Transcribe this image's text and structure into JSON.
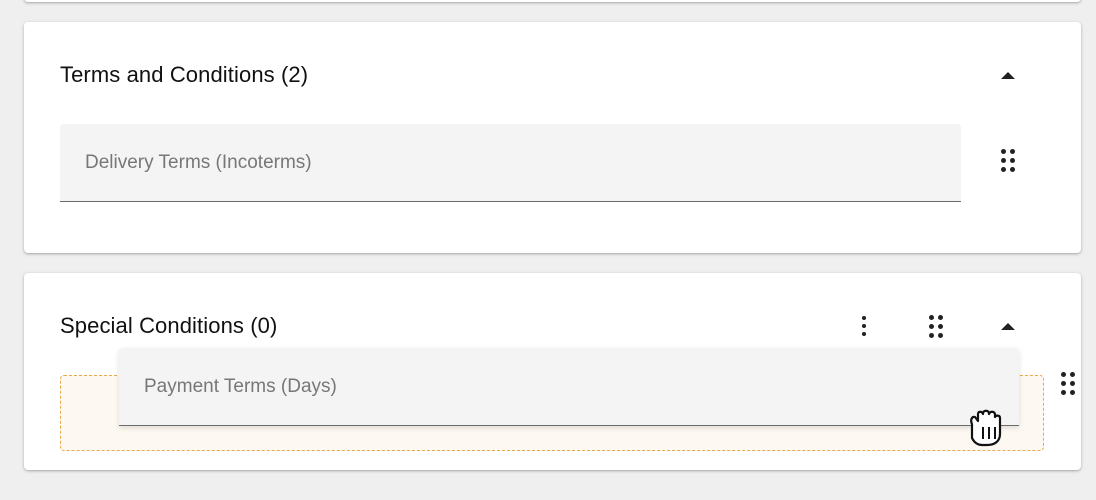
{
  "sections": {
    "terms": {
      "title": "Terms and Conditions (2)",
      "field_label": "Delivery Terms (Incoterms)"
    },
    "special": {
      "title": "Special Conditions (0)"
    }
  },
  "drag": {
    "field_label": "Payment Terms (Days)"
  },
  "icons": {
    "collapse": "caret-up-icon",
    "drag": "drag-handle-icon",
    "more": "more-vert-icon",
    "cursor": "grab-hand-cursor"
  }
}
